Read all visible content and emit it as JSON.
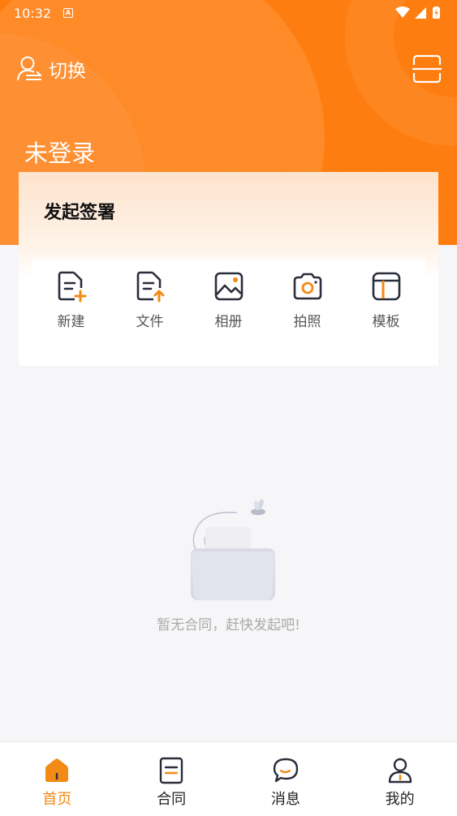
{
  "statusbar": {
    "time": "10:32"
  },
  "header": {
    "switch_label": "切换",
    "login_status": "未登录"
  },
  "card": {
    "title": "发起签署",
    "actions": [
      {
        "label": "新建",
        "icon": "new-document-icon"
      },
      {
        "label": "文件",
        "icon": "upload-file-icon"
      },
      {
        "label": "相册",
        "icon": "image-icon"
      },
      {
        "label": "拍照",
        "icon": "camera-icon"
      },
      {
        "label": "模板",
        "icon": "template-icon"
      }
    ]
  },
  "empty_state": {
    "message": "暂无合同，赶快发起吧!"
  },
  "tabbar": {
    "tabs": [
      {
        "label": "首页",
        "icon": "home-icon",
        "active": true
      },
      {
        "label": "合同",
        "icon": "contract-icon",
        "active": false
      },
      {
        "label": "消息",
        "icon": "message-icon",
        "active": false
      },
      {
        "label": "我的",
        "icon": "profile-icon",
        "active": false
      }
    ]
  },
  "colors": {
    "accent": "#fe7d10",
    "accent_icon": "#f28a16",
    "text_dark": "#111111"
  }
}
